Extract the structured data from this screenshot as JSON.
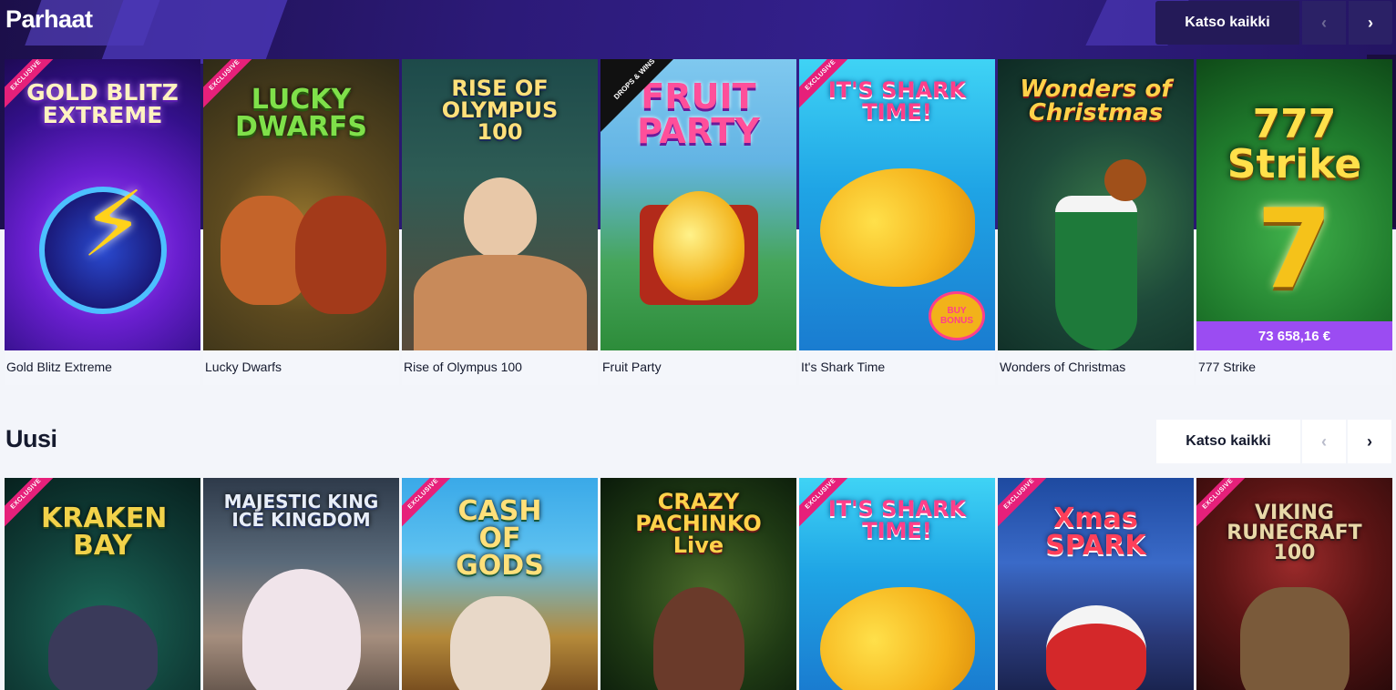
{
  "sections": {
    "top": {
      "title": "Parhaat",
      "see_all_label": "Katso kaikki",
      "prev_icon": "‹",
      "next_icon": "›",
      "games": [
        {
          "name": "Gold Blitz Extreme",
          "art_title": "GOLD BLITZ EXTREME",
          "exclusive": "EXCLUSIVE"
        },
        {
          "name": "Lucky Dwarfs",
          "art_title": "LUCKY DWARFS",
          "exclusive": "EXCLUSIVE"
        },
        {
          "name": "Rise of Olympus 100",
          "art_title": "RISE OF OLYMPUS 100"
        },
        {
          "name": "Fruit Party",
          "art_title": "FRUIT PARTY",
          "badge": "DROPS & WINS"
        },
        {
          "name": "It's Shark Time",
          "art_title": "IT'S SHARK TIME!",
          "exclusive": "EXCLUSIVE",
          "art_badge": "BUY BONUS"
        },
        {
          "name": "Wonders of Christmas",
          "art_title": "Wonders of Christmas"
        },
        {
          "name": "777 Strike",
          "art_title": "777 Strike",
          "jackpot": "73 658,16 €"
        }
      ]
    },
    "new": {
      "title": "Uusi",
      "see_all_label": "Katso kaikki",
      "prev_icon": "‹",
      "next_icon": "›",
      "games": [
        {
          "art_title": "KRAKEN BAY",
          "exclusive": "EXCLUSIVE"
        },
        {
          "art_title": "MAJESTIC KING ICE KINGDOM"
        },
        {
          "art_title": "CASH OF GODS",
          "exclusive": "EXCLUSIVE"
        },
        {
          "art_title": "CRAZY PACHINKO Live"
        },
        {
          "art_title": "IT'S SHARK TIME!",
          "exclusive": "EXCLUSIVE"
        },
        {
          "art_title": "Xmas SPARK",
          "exclusive": "EXCLUSIVE"
        },
        {
          "art_title": "VIKING RUNECRAFT 100",
          "exclusive": "EXCLUSIVE"
        }
      ]
    }
  },
  "colors": {
    "hero_band": "#2c1a78",
    "exclusive_ribbon": "#e6207a",
    "jackpot_bar": "#9b4cf2",
    "page_background": "#f3f5fa"
  }
}
